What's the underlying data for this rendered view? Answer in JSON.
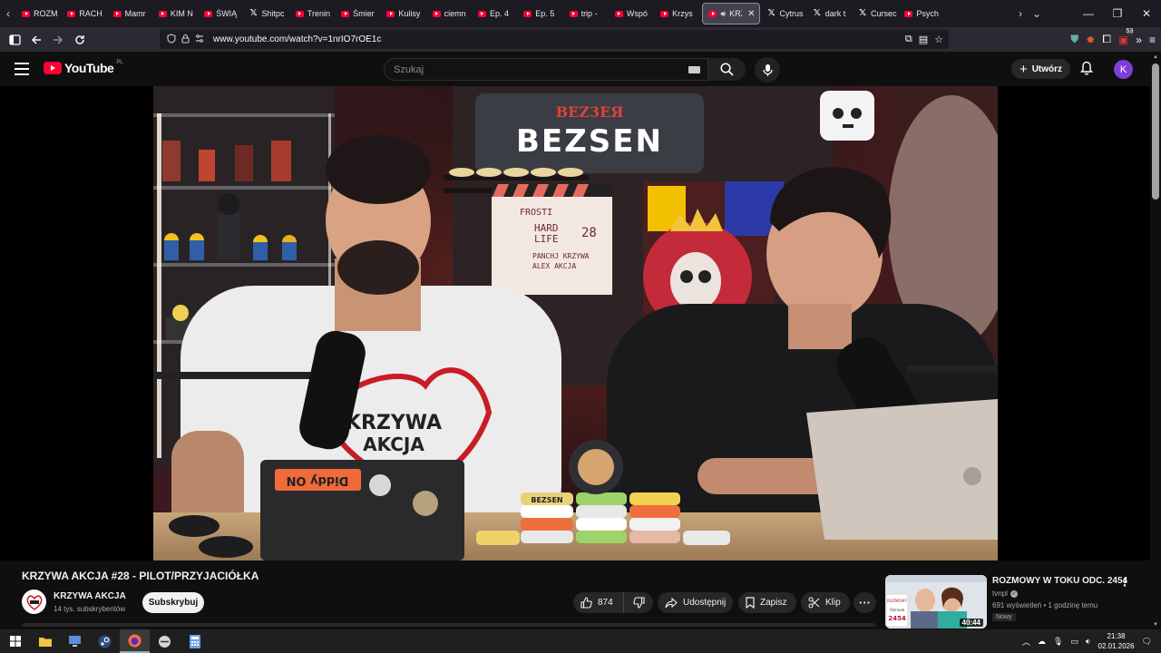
{
  "browser": {
    "tabs": [
      {
        "label": "ROZM",
        "icon": "youtube-icon"
      },
      {
        "label": "RACH",
        "icon": "youtube-icon"
      },
      {
        "label": "Mamr",
        "icon": "youtube-icon"
      },
      {
        "label": "KIM N",
        "icon": "youtube-icon"
      },
      {
        "label": "ŚWIĄ",
        "icon": "youtube-icon"
      },
      {
        "label": "Shitpc",
        "icon": "x-icon"
      },
      {
        "label": "Trenin",
        "icon": "youtube-icon"
      },
      {
        "label": "Śmier",
        "icon": "youtube-icon"
      },
      {
        "label": "Kulisy",
        "icon": "youtube-icon"
      },
      {
        "label": "ciemn",
        "icon": "youtube-icon"
      },
      {
        "label": "Ep. 4",
        "icon": "youtube-icon"
      },
      {
        "label": "Ep. 5",
        "icon": "youtube-icon"
      },
      {
        "label": "trip -",
        "icon": "youtube-icon"
      },
      {
        "label": "Wspó",
        "icon": "youtube-icon"
      },
      {
        "label": "Krzys",
        "icon": "youtube-icon"
      }
    ],
    "active_tab": {
      "label": "KRZ"
    },
    "tabs_after": [
      {
        "label": "Cytrus",
        "icon": "x-icon"
      },
      {
        "label": "dark t",
        "icon": "x-icon"
      },
      {
        "label": "Cursec",
        "icon": "x-icon"
      },
      {
        "label": "Psych",
        "icon": "youtube-icon"
      }
    ],
    "url": "www.youtube.com/watch?v=1nrIO7rOE1c",
    "extensions_badge": "53"
  },
  "youtube": {
    "logo_text": "YouTube",
    "country_code": "PL",
    "search_placeholder": "Szukaj",
    "create_label": "Utwórz",
    "avatar_letter": "K"
  },
  "video": {
    "title": "KRZYWA AKCJA #28 - PILOT/PRZYJACIÓŁKA",
    "channel_name": "KRZYWA AKCJA",
    "subscribers": "14 tys. subskrybentów",
    "subscribe_label": "Subskrybuj",
    "likes": "874",
    "share_label": "Udostępnij",
    "save_label": "Zapisz",
    "clip_label": "Klip",
    "scene_text": {
      "sign_small": "BEZ3EЯ",
      "sign_large": "BEZSEN",
      "clapper_line1": "FROSTI",
      "clapper_line2": "HARD",
      "clapper_line3": "LIFE",
      "clapper_number": "28",
      "clapper_names": "PANCHJ KRZYWA",
      "clapper_names2": "ALEX AKCJA",
      "shirt_text1": "KRZYWA",
      "shirt_text2": "AKCJA",
      "laptop_sticker": "Diddy ON",
      "can_brand": "BEZSEN"
    }
  },
  "recommendation": {
    "title": "ROZMOWY W TOKU ODC. 2454",
    "channel": "tvnpl",
    "meta": "691 wyświetleń • 1 godzinę temu",
    "badge": "Nowy",
    "duration": "40:44",
    "thumb_badge_top": "ROZMOWY",
    "thumb_badge_mid": "Odcinek",
    "thumb_badge_num": "2454"
  },
  "taskbar": {
    "time": "21:38",
    "date": "02.01.2026"
  },
  "colors": {
    "yt_red": "#ff0033",
    "avatar_purple": "#7e3fd6",
    "page_bg": "#0f0f0f"
  }
}
